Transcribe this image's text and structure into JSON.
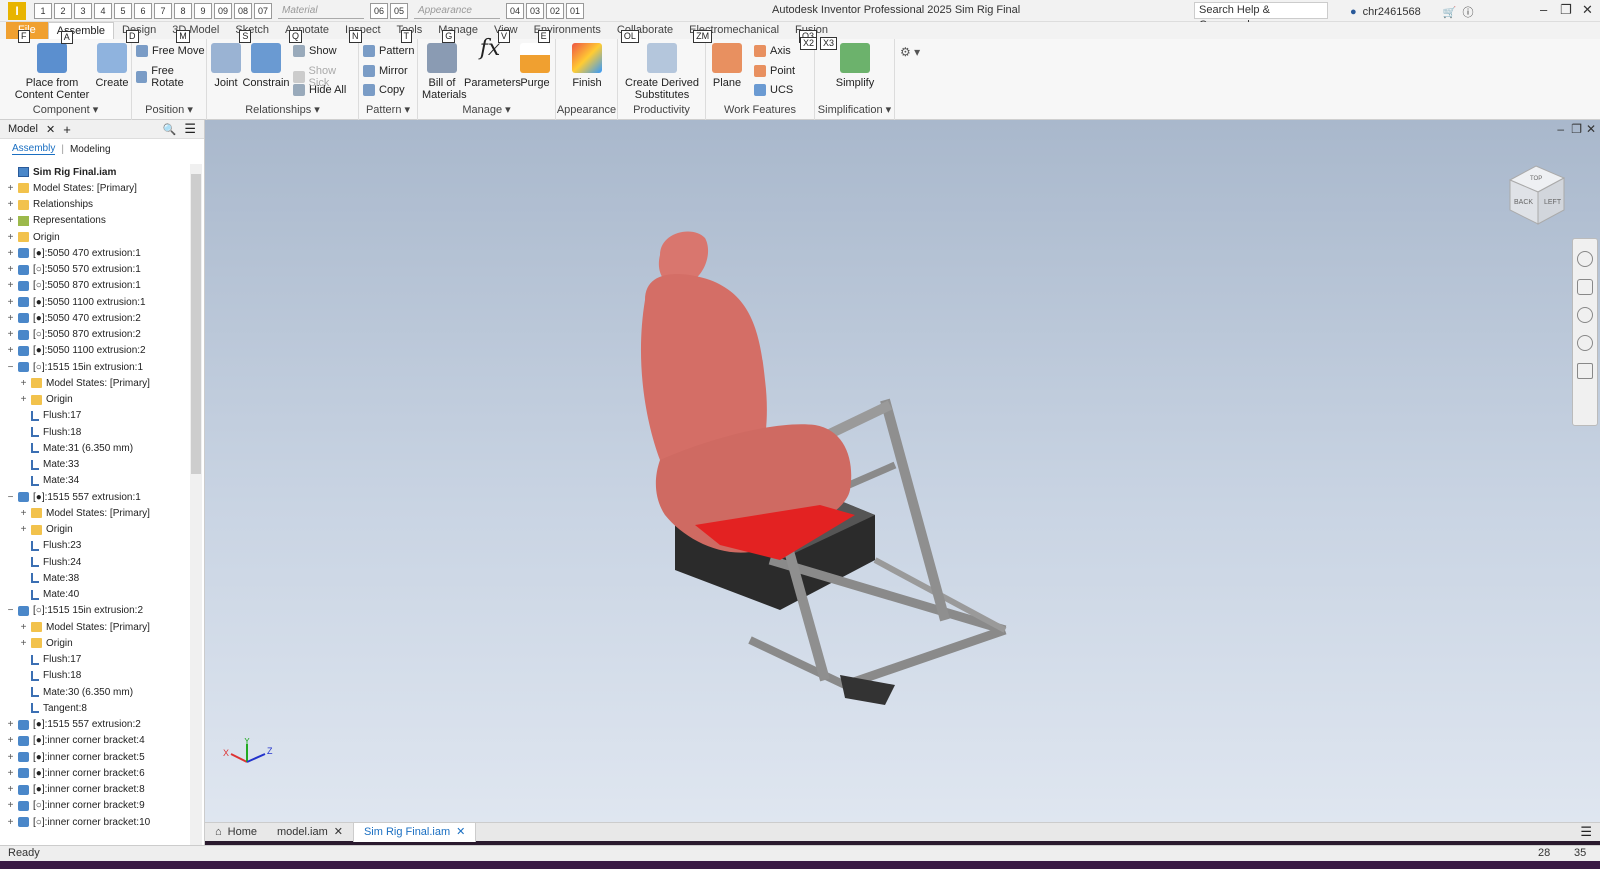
{
  "titlebar": {
    "app_icon": "I",
    "qat_keytips": [
      "1",
      "2",
      "3",
      "4",
      "5",
      "6",
      "7",
      "8",
      "9",
      "09",
      "08",
      "07",
      "06",
      "05",
      "04",
      "03",
      "02",
      "01"
    ],
    "material_placeholder": "Material",
    "appearance_placeholder": "Appearance",
    "title": "Autodesk Inventor Professional 2025   Sim Rig Final",
    "search_placeholder": "Search Help & Commands...",
    "user": "chr2461568"
  },
  "ribbon_tabs": [
    {
      "label": "File",
      "key": "F"
    },
    {
      "label": "Assemble",
      "key": "A"
    },
    {
      "label": "Design",
      "key": "D"
    },
    {
      "label": "3D Model",
      "key": "M"
    },
    {
      "label": "Sketch",
      "key": "S"
    },
    {
      "label": "Annotate",
      "key": "Q"
    },
    {
      "label": "Inspect",
      "key": "N"
    },
    {
      "label": "Tools",
      "key": "T"
    },
    {
      "label": "Manage",
      "key": "G"
    },
    {
      "label": "View",
      "key": "V"
    },
    {
      "label": "Environments",
      "key": "E"
    },
    {
      "label": "Collaborate",
      "key": "OL"
    },
    {
      "label": "Electromechanical",
      "key": "ZM"
    },
    {
      "label": "Fusion",
      "key": "O3"
    }
  ],
  "ribbon": {
    "component": {
      "title": "Component",
      "place": "Place from\nContent Center",
      "create": "Create"
    },
    "position": {
      "title": "Position",
      "free_move": "Free Move",
      "free_rotate": "Free Rotate"
    },
    "relationships": {
      "title": "Relationships",
      "joint": "Joint",
      "constrain": "Constrain",
      "show": "Show",
      "show_sick": "Show Sick",
      "hide_all": "Hide All"
    },
    "pattern": {
      "title": "Pattern",
      "pattern": "Pattern",
      "mirror": "Mirror",
      "copy": "Copy"
    },
    "manage": {
      "title": "Manage",
      "bom": "Bill of\nMaterials",
      "parameters": "Parameters",
      "purge": "Purge"
    },
    "appearance": {
      "title": "Appearance",
      "finish": "Finish"
    },
    "productivity": {
      "title": "Productivity",
      "derived": "Create Derived\nSubstitutes"
    },
    "work_features": {
      "title": "Work Features",
      "plane": "Plane",
      "axis": "Axis",
      "point": "Point",
      "ucs": "UCS"
    },
    "simplification": {
      "title": "Simplification",
      "simplify": "Simplify"
    },
    "extra_keytips": [
      "X2",
      "X3"
    ]
  },
  "browser": {
    "tab": "Model",
    "sub_assembly": "Assembly",
    "sub_modeling": "Modeling",
    "nodes": [
      {
        "label": "Sim Rig Final.iam",
        "exp": "",
        "icon": "asm",
        "indent": 0,
        "bold": true
      },
      {
        "label": "Model States: [Primary]",
        "exp": "+",
        "icon": "folder",
        "indent": 0
      },
      {
        "label": "Relationships",
        "exp": "+",
        "icon": "folder",
        "indent": 0
      },
      {
        "label": "Representations",
        "exp": "+",
        "icon": "rep",
        "indent": 0
      },
      {
        "label": "Origin",
        "exp": "+",
        "icon": "folder",
        "indent": 0
      },
      {
        "label": "[●]:5050 470 extrusion:1",
        "exp": "+",
        "icon": "part",
        "indent": 0
      },
      {
        "label": "[○]:5050 570 extrusion:1",
        "exp": "+",
        "icon": "part",
        "indent": 0
      },
      {
        "label": "[○]:5050 870 extrusion:1",
        "exp": "+",
        "icon": "part",
        "indent": 0
      },
      {
        "label": "[●]:5050 1100 extrusion:1",
        "exp": "+",
        "icon": "part",
        "indent": 0
      },
      {
        "label": "[●]:5050 470 extrusion:2",
        "exp": "+",
        "icon": "part",
        "indent": 0
      },
      {
        "label": "[○]:5050 870 extrusion:2",
        "exp": "+",
        "icon": "part",
        "indent": 0
      },
      {
        "label": "[●]:5050 1100 extrusion:2",
        "exp": "+",
        "icon": "part",
        "indent": 0
      },
      {
        "label": "[○]:1515 15in extrusion:1",
        "exp": "−",
        "icon": "part",
        "indent": 0
      },
      {
        "label": "Model States: [Primary]",
        "exp": "+",
        "icon": "folder",
        "indent": 1
      },
      {
        "label": "Origin",
        "exp": "+",
        "icon": "folder",
        "indent": 1
      },
      {
        "label": "Flush:17",
        "exp": "",
        "icon": "con",
        "indent": 1
      },
      {
        "label": "Flush:18",
        "exp": "",
        "icon": "con",
        "indent": 1
      },
      {
        "label": "Mate:31 (6.350 mm)",
        "exp": "",
        "icon": "con",
        "indent": 1
      },
      {
        "label": "Mate:33",
        "exp": "",
        "icon": "con",
        "indent": 1
      },
      {
        "label": "Mate:34",
        "exp": "",
        "icon": "con",
        "indent": 1
      },
      {
        "label": "[●]:1515 557 extrusion:1",
        "exp": "−",
        "icon": "part",
        "indent": 0
      },
      {
        "label": "Model States: [Primary]",
        "exp": "+",
        "icon": "folder",
        "indent": 1
      },
      {
        "label": "Origin",
        "exp": "+",
        "icon": "folder",
        "indent": 1
      },
      {
        "label": "Flush:23",
        "exp": "",
        "icon": "con",
        "indent": 1
      },
      {
        "label": "Flush:24",
        "exp": "",
        "icon": "con",
        "indent": 1
      },
      {
        "label": "Mate:38",
        "exp": "",
        "icon": "con",
        "indent": 1
      },
      {
        "label": "Mate:40",
        "exp": "",
        "icon": "con",
        "indent": 1
      },
      {
        "label": "[○]:1515 15in extrusion:2",
        "exp": "−",
        "icon": "part",
        "indent": 0
      },
      {
        "label": "Model States: [Primary]",
        "exp": "+",
        "icon": "folder",
        "indent": 1
      },
      {
        "label": "Origin",
        "exp": "+",
        "icon": "folder",
        "indent": 1
      },
      {
        "label": "Flush:17",
        "exp": "",
        "icon": "con",
        "indent": 1
      },
      {
        "label": "Flush:18",
        "exp": "",
        "icon": "con",
        "indent": 1
      },
      {
        "label": "Mate:30 (6.350 mm)",
        "exp": "",
        "icon": "con",
        "indent": 1
      },
      {
        "label": "Tangent:8",
        "exp": "",
        "icon": "con",
        "indent": 1
      },
      {
        "label": "[●]:1515 557 extrusion:2",
        "exp": "+",
        "icon": "part",
        "indent": 0
      },
      {
        "label": "[●]:inner corner bracket:4",
        "exp": "+",
        "icon": "part",
        "indent": 0
      },
      {
        "label": "[●]:inner corner bracket:5",
        "exp": "+",
        "icon": "part",
        "indent": 0
      },
      {
        "label": "[●]:inner corner bracket:6",
        "exp": "+",
        "icon": "part",
        "indent": 0
      },
      {
        "label": "[●]:inner corner bracket:8",
        "exp": "+",
        "icon": "part",
        "indent": 0
      },
      {
        "label": "[○]:inner corner bracket:9",
        "exp": "+",
        "icon": "part",
        "indent": 0
      },
      {
        "label": "[○]:inner corner bracket:10",
        "exp": "+",
        "icon": "part",
        "indent": 0
      }
    ]
  },
  "viewcube": {
    "back": "BACK",
    "left": "LEFT",
    "top": "TOP"
  },
  "triad": {
    "x": "X",
    "y": "Y",
    "z": "Z"
  },
  "doctabs": {
    "home": "Home",
    "model": "model.iam",
    "active": "Sim Rig Final.iam"
  },
  "status": {
    "text": "Ready",
    "n1": "28",
    "n2": "35"
  },
  "colors": {
    "seat": "#d9766e",
    "frame": "#8a8a8a",
    "accent": "#1a6fc2",
    "file_tab": "#f0a030"
  }
}
